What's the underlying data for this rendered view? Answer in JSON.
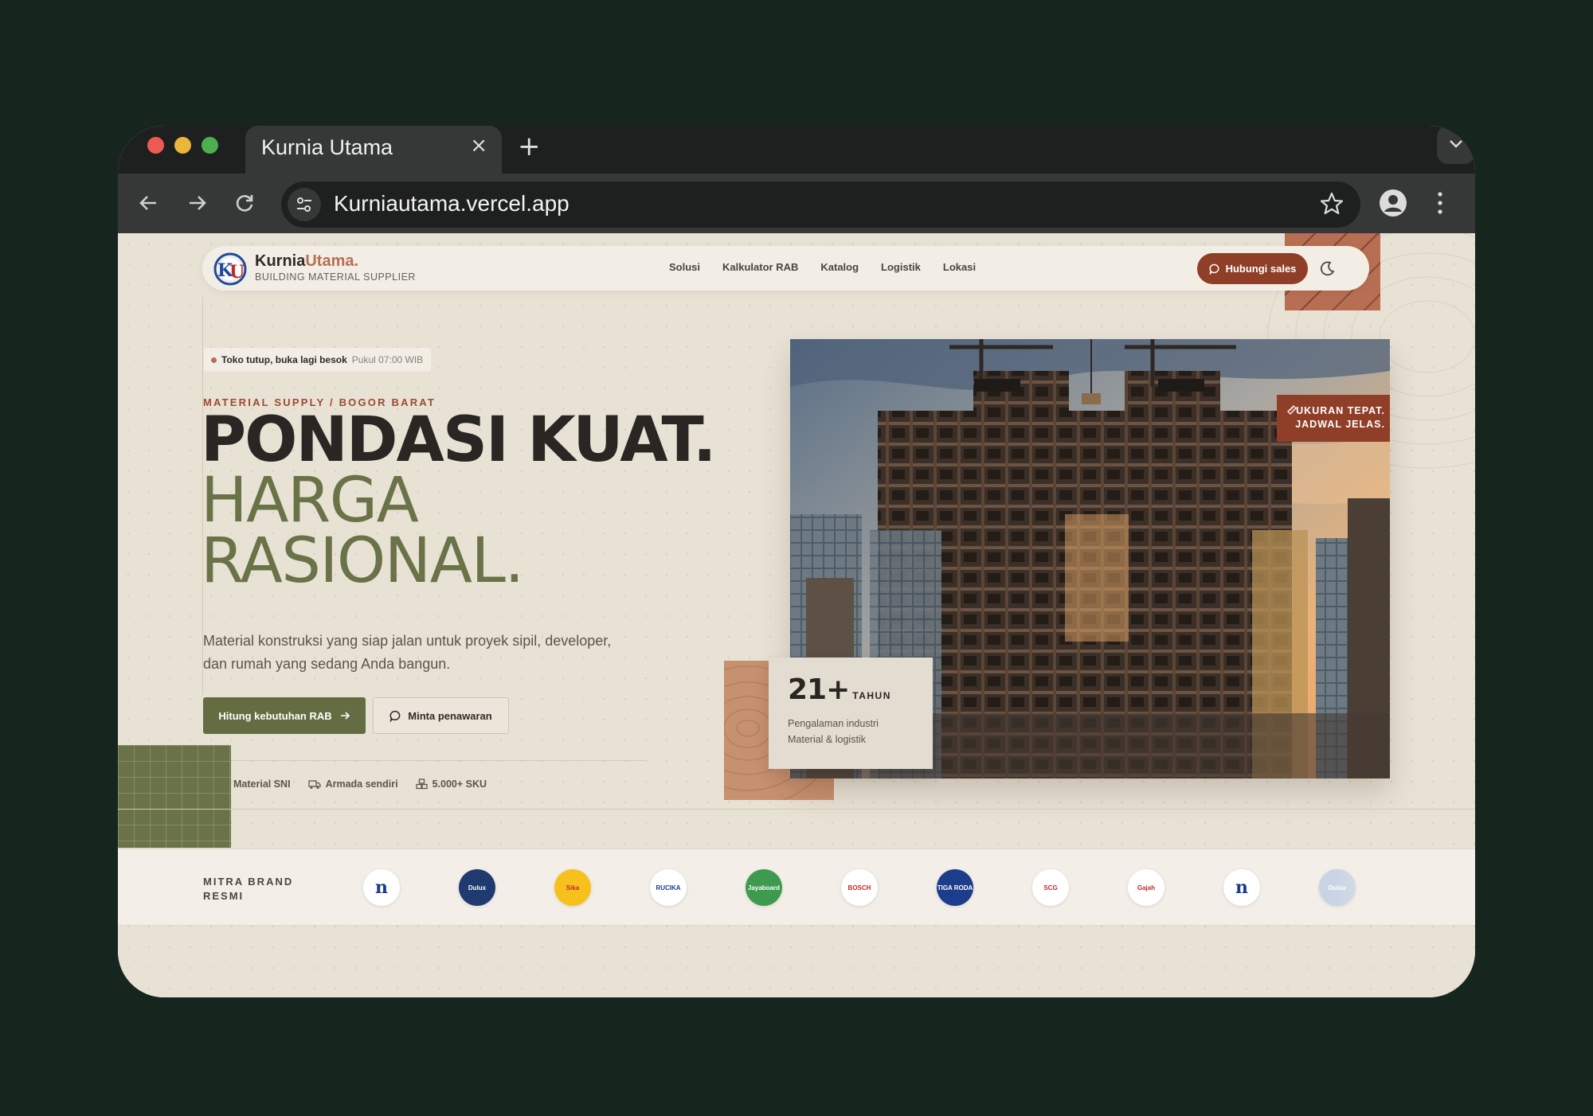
{
  "browser": {
    "tab_title": "Kurnia Utama",
    "tab_close": "×",
    "new_tab": "+",
    "url": "Kurniautama.vercel.app"
  },
  "nav": {
    "brand_first": "Kurnia",
    "brand_accent": "Utama.",
    "brand_sub": "BUILDING MATERIAL SUPPLIER",
    "logo_text": "KU",
    "menu": [
      "Solusi",
      "Kalkulator RAB",
      "Katalog",
      "Logistik",
      "Lokasi"
    ],
    "cta": "Hubungi sales"
  },
  "hero": {
    "status_strong": "Toko tutup, buka lagi besok",
    "status_light": "Pukul 07:00 WIB",
    "eyebrow": "MATERIAL SUPPLY / BOGOR BARAT",
    "line1": "PONDASI KUAT.",
    "line2": "HARGA",
    "line3": "RASIONAL.",
    "lede": "Material konstruksi yang siap jalan untuk proyek sipil, developer, dan rumah yang sedang Anda bangun.",
    "primary_cta": "Hitung kebutuhan RAB",
    "secondary_cta": "Minta penawaran",
    "features": [
      "Material SNI",
      "Armada sendiri",
      "5.000+ SKU"
    ],
    "image_tag_line1": "UKURAN TEPAT.",
    "image_tag_line2": "JADWAL JELAS.",
    "stat_number": "21+",
    "stat_unit": "TAHUN",
    "stat_line1": "Pengalaman industri",
    "stat_line2": "Material & logistik"
  },
  "brands": {
    "label": "MITRA BRAND RESMI",
    "logos": [
      {
        "text": "n",
        "bg": "#ffffff",
        "fg": "#1c3c8c"
      },
      {
        "text": "Dulux",
        "bg": "#1f3a70",
        "fg": "#ffffff"
      },
      {
        "text": "Sika",
        "bg": "#f6c11d",
        "fg": "#c62828"
      },
      {
        "text": "RUCIKA",
        "bg": "#ffffff",
        "fg": "#1c3c8c"
      },
      {
        "text": "Jayaboard",
        "bg": "#3d9a4e",
        "fg": "#ffffff"
      },
      {
        "text": "BOSCH",
        "bg": "#ffffff",
        "fg": "#c62828"
      },
      {
        "text": "TIGA RODA",
        "bg": "#1c3c8c",
        "fg": "#ffffff"
      },
      {
        "text": "SCG",
        "bg": "#ffffff",
        "fg": "#c62828"
      },
      {
        "text": "Gajah",
        "bg": "#ffffff",
        "fg": "#c62828"
      },
      {
        "text": "n",
        "bg": "#ffffff",
        "fg": "#1c3c8c"
      },
      {
        "text": "Dulux",
        "bg": "#c9d3e6",
        "fg": "#ffffff"
      }
    ]
  },
  "colors": {
    "accent_rust": "#8f3f28",
    "accent_olive": "#646c42",
    "page_bg": "#e8e2d5"
  }
}
